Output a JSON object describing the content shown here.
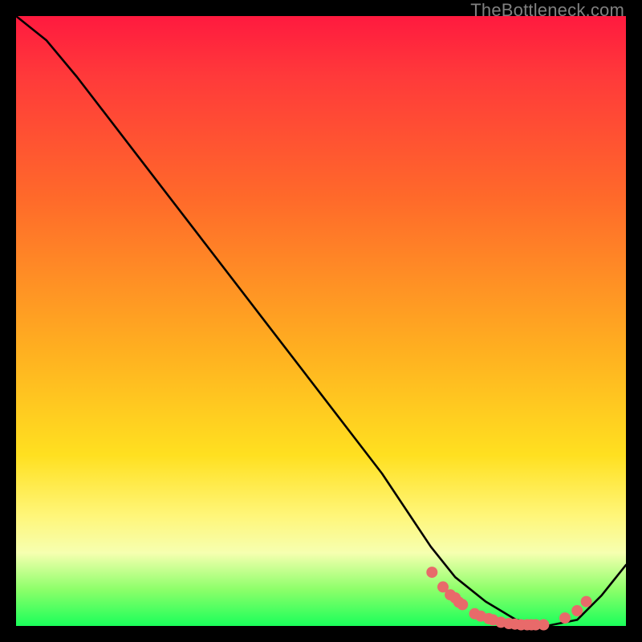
{
  "watermark": "TheBottleneck.com",
  "colors": {
    "background": "#000000",
    "gradient_stops": [
      "#ff1a3f",
      "#ff3a3a",
      "#ff6a2a",
      "#ffb020",
      "#ffe020",
      "#fff67a",
      "#f6ffb0",
      "#8dff6a",
      "#1aff5a"
    ],
    "curve": "#000000",
    "points": "#e86a6a"
  },
  "chart_data": {
    "type": "line",
    "title": "",
    "xlabel": "",
    "ylabel": "",
    "xlim": [
      0,
      1
    ],
    "ylim": [
      0,
      1
    ],
    "series": [
      {
        "name": "curve",
        "x": [
          0.0,
          0.05,
          0.1,
          0.2,
          0.3,
          0.4,
          0.5,
          0.6,
          0.68,
          0.72,
          0.77,
          0.82,
          0.87,
          0.92,
          0.96,
          1.0
        ],
        "y": [
          1.0,
          0.96,
          0.9,
          0.77,
          0.64,
          0.51,
          0.38,
          0.25,
          0.13,
          0.08,
          0.04,
          0.01,
          0.0,
          0.01,
          0.05,
          0.1
        ]
      }
    ],
    "points": [
      {
        "x": 0.682,
        "y": 0.088
      },
      {
        "x": 0.7,
        "y": 0.064
      },
      {
        "x": 0.712,
        "y": 0.051
      },
      {
        "x": 0.72,
        "y": 0.046
      },
      {
        "x": 0.726,
        "y": 0.039
      },
      {
        "x": 0.732,
        "y": 0.035
      },
      {
        "x": 0.752,
        "y": 0.02
      },
      {
        "x": 0.762,
        "y": 0.016
      },
      {
        "x": 0.775,
        "y": 0.012
      },
      {
        "x": 0.782,
        "y": 0.01
      },
      {
        "x": 0.795,
        "y": 0.006
      },
      {
        "x": 0.808,
        "y": 0.004
      },
      {
        "x": 0.818,
        "y": 0.003
      },
      {
        "x": 0.828,
        "y": 0.002
      },
      {
        "x": 0.838,
        "y": 0.002
      },
      {
        "x": 0.845,
        "y": 0.002
      },
      {
        "x": 0.852,
        "y": 0.002
      },
      {
        "x": 0.865,
        "y": 0.002
      },
      {
        "x": 0.9,
        "y": 0.013
      },
      {
        "x": 0.92,
        "y": 0.025
      },
      {
        "x": 0.935,
        "y": 0.04
      }
    ]
  }
}
